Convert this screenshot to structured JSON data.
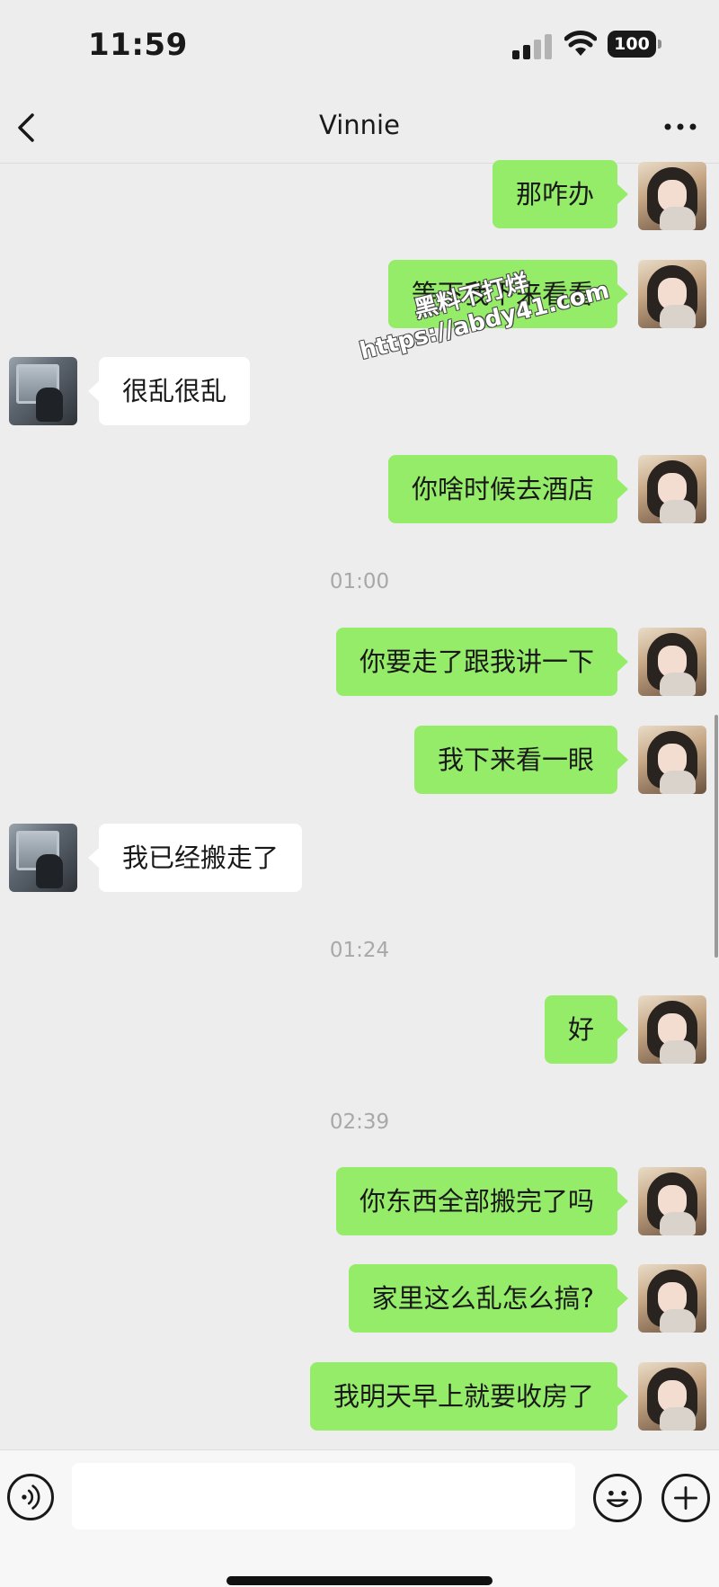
{
  "status_bar": {
    "time": "11:59",
    "battery": "100"
  },
  "nav": {
    "title": "Vinnie"
  },
  "messages": [
    {
      "side": "me",
      "text": "那咋办"
    },
    {
      "side": "me",
      "text": "等下我下来看看"
    },
    {
      "side": "other",
      "text": "很乱很乱"
    },
    {
      "side": "me",
      "text": "你啥时候去酒店"
    },
    {
      "timestamp": "01:00"
    },
    {
      "side": "me",
      "text": "你要走了跟我讲一下"
    },
    {
      "side": "me",
      "text": "我下来看一眼"
    },
    {
      "side": "other",
      "text": "我已经搬走了"
    },
    {
      "timestamp": "01:24"
    },
    {
      "side": "me",
      "text": "好"
    },
    {
      "timestamp": "02:39"
    },
    {
      "side": "me",
      "text": "你东西全部搬完了吗"
    },
    {
      "side": "me",
      "text": "家里这么乱怎么搞?"
    },
    {
      "side": "me",
      "text": "我明天早上就要收房了"
    }
  ],
  "watermark": {
    "line1": "黑料不打烊",
    "line2": "https://abdy41.com"
  },
  "input": {
    "value": ""
  },
  "icons": {
    "back": "chevron-left-icon",
    "more": "more-dots-icon",
    "voice": "voice-icon",
    "emoji": "emoji-icon",
    "add": "plus-icon"
  },
  "colors": {
    "my_bubble": "#95ec69",
    "other_bubble": "#ffffff",
    "background": "#ededed"
  }
}
